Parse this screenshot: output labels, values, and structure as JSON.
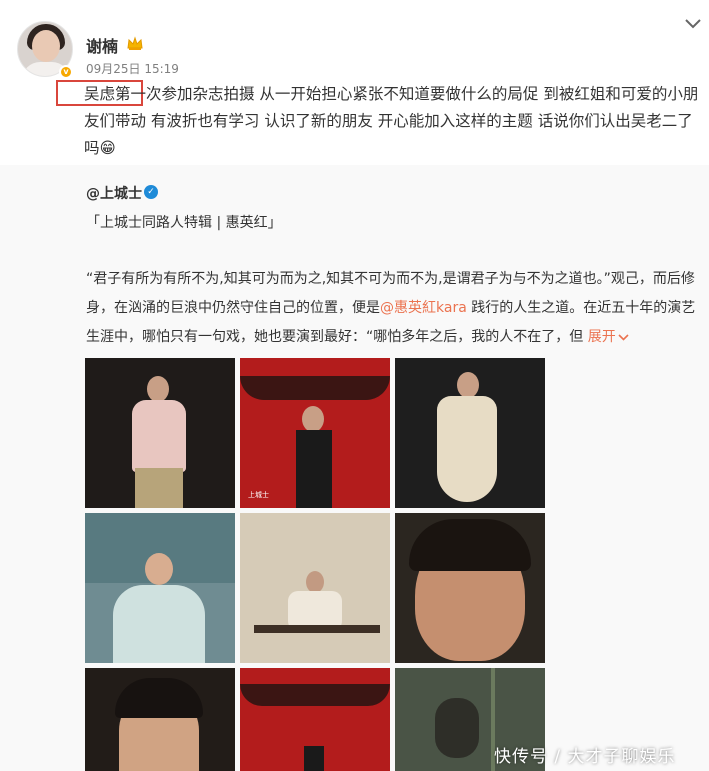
{
  "post": {
    "username": "谢楠",
    "time": "09月25日 15:19",
    "text": "吴虑第一次参加杂志拍摄 从一开始担心紧张不知道要做什么的局促 到被红姐和可爱的小朋友们带动 有波折也有学习 认识了新的朋友 开心能加入这样的主题 话说你们认出吴老二了吗😁",
    "highlighted_phrase": "吴虑第一"
  },
  "repost": {
    "author": "@上城士",
    "tag": "「上城士同路人特辑 | 惠英红」",
    "text_before_mention": "“君子有所为有所不为,知其可为而为之,知其不可为而不为,是谓君子为与不为之道也。”观己，而后修身，在汹涌的巨浪中仍然守住自己的位置，便是",
    "mention": "@惠英紅kara",
    "text_after_mention": " 践行的人生之道。在近五十年的演艺生涯中，哪怕只有一句戏，她也要演到最好：“哪怕多年之后，我的人不在了，但 ",
    "expand_label": "展开",
    "photo_caption": "上城士"
  },
  "icons": {
    "crown": "crown-icon",
    "verified": "verified-icon",
    "chevron": "chevron-down-icon",
    "expand": "chevron-down-small-icon"
  },
  "colors": {
    "accent": "#eb7350",
    "highlight_border": "#d9463c",
    "verified": "#1f8bd8",
    "badge": "#f7a800"
  },
  "watermark": "快传号 / 大才子聊娱乐"
}
